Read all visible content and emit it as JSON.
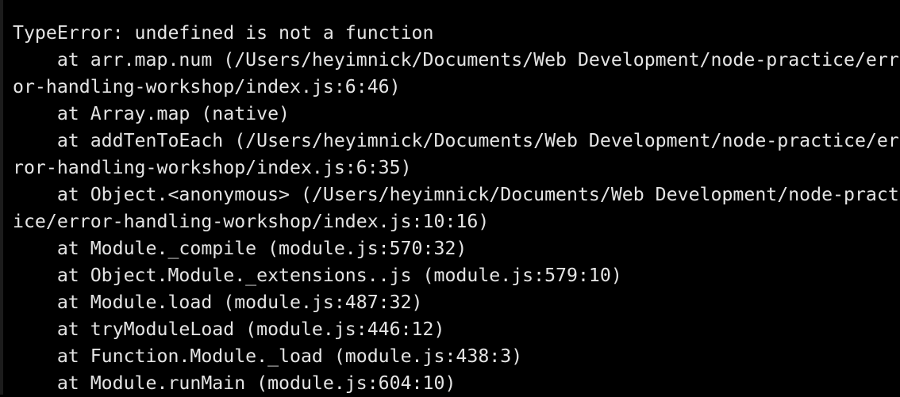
{
  "terminal": {
    "lines": [
      "TypeError: undefined is not a function",
      "    at arr.map.num (/Users/heyimnick/Documents/Web Development/node-practice/err",
      "or-handling-workshop/index.js:6:46)",
      "    at Array.map (native)",
      "    at addTenToEach (/Users/heyimnick/Documents/Web Development/node-practice/er",
      "ror-handling-workshop/index.js:6:35)",
      "    at Object.<anonymous> (/Users/heyimnick/Documents/Web Development/node-pract",
      "ice/error-handling-workshop/index.js:10:16)",
      "    at Module._compile (module.js:570:32)",
      "    at Object.Module._extensions..js (module.js:579:10)",
      "    at Module.load (module.js:487:32)",
      "    at tryModuleLoad (module.js:446:12)",
      "    at Function.Module._load (module.js:438:3)",
      "    at Module.runMain (module.js:604:10)"
    ]
  }
}
